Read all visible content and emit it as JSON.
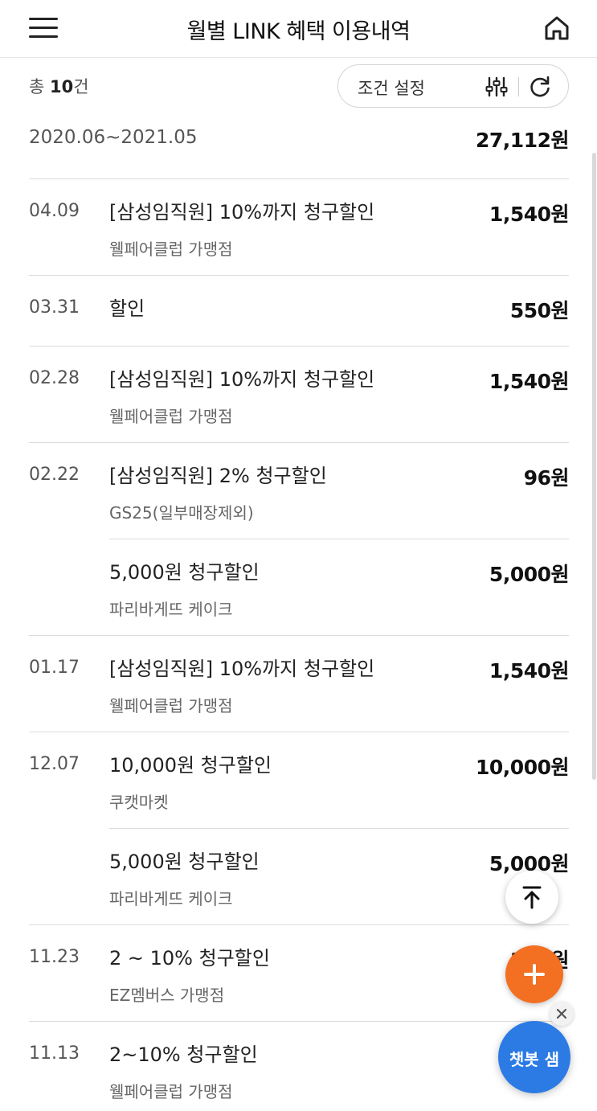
{
  "header": {
    "title": "월별 LINK 혜택 이용내역",
    "menu_icon": "hamburger-menu-icon",
    "home_icon": "home-icon"
  },
  "summary": {
    "prefix": "총 ",
    "count": "10",
    "suffix": "건"
  },
  "filter": {
    "label": "조건 설정",
    "filter_icon": "sliders-icon",
    "refresh_icon": "refresh-icon"
  },
  "period": {
    "range": "2020.06~2021.05",
    "total": "27,112원"
  },
  "items": [
    {
      "date": "04.09",
      "name": "[삼성임직원] 10%까지  청구할인",
      "sub": "웰페어클럽 가맹점",
      "amount": "1,540원"
    },
    {
      "date": "03.31",
      "name": " 할인",
      "sub": "",
      "amount": "550원"
    },
    {
      "date": "02.28",
      "name": "[삼성임직원] 10%까지  청구할인",
      "sub": "웰페어클럽 가맹점",
      "amount": "1,540원"
    },
    {
      "date": "02.22",
      "name": "[삼성임직원] 2%  청구할인",
      "sub": "GS25(일부매장제외)",
      "amount": "96원"
    },
    {
      "date": "",
      "name": "5,000원  청구할인",
      "sub": "파리바게뜨 케이크",
      "amount": "5,000원"
    },
    {
      "date": "01.17",
      "name": "[삼성임직원] 10%까지  청구할인",
      "sub": "웰페어클럽 가맹점",
      "amount": "1,540원"
    },
    {
      "date": "12.07",
      "name": "10,000원  청구할인",
      "sub": "쿠캣마켓",
      "amount": "10,000원"
    },
    {
      "date": "",
      "name": "5,000원  청구할인",
      "sub": "파리바게뜨 케이크",
      "amount": "5,000원"
    },
    {
      "date": "11.23",
      "name": "2 ~ 10%  청구할인",
      "sub": "EZ멤버스 가맹점",
      "amount": "306원"
    },
    {
      "date": "11.13",
      "name": "2~10%  청구할인",
      "sub": "웰페어클럽 가맹점",
      "amount": ""
    }
  ],
  "floating": {
    "top_icon": "arrow-up-icon",
    "plus_icon": "plus-icon",
    "close_icon": "close-icon",
    "chatbot_label": "챗봇 샘"
  },
  "colors": {
    "accent_orange": "#f36f21",
    "chatbot_blue": "#2c7be5"
  }
}
